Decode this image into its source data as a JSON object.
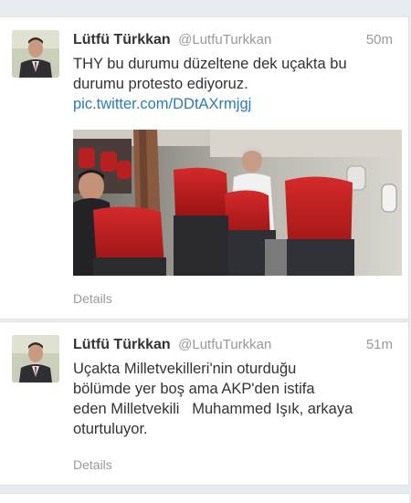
{
  "tweets": [
    {
      "fullname": "Lütfü Türkkan",
      "username": "@LutfuTurkkan",
      "time": "50m",
      "text_line1": "THY bu durumu düzeltene dek uçakta bu",
      "text_line2": "durumu protesto ediyoruz.",
      "link": "pic.twitter.com/DDtAXrmjgj",
      "details_label": "Details",
      "media": "airplane-cabin-photo"
    },
    {
      "fullname": "Lütfü Türkkan",
      "username": "@LutfuTurkkan",
      "time": "51m",
      "text_line1": "Uçakta Milletvekilleri'nin oturduğu",
      "text_line2": "bölümde yer boş ama AKP'den istifa",
      "text_line3": "eden Milletvekili   Muhammed Işık, arkaya",
      "text_line4": "oturtuluyor.",
      "details_label": "Details"
    }
  ],
  "colors": {
    "link": "#2b7bb9",
    "name": "#333333",
    "muted": "#999999",
    "background": "#e6ecf0"
  }
}
